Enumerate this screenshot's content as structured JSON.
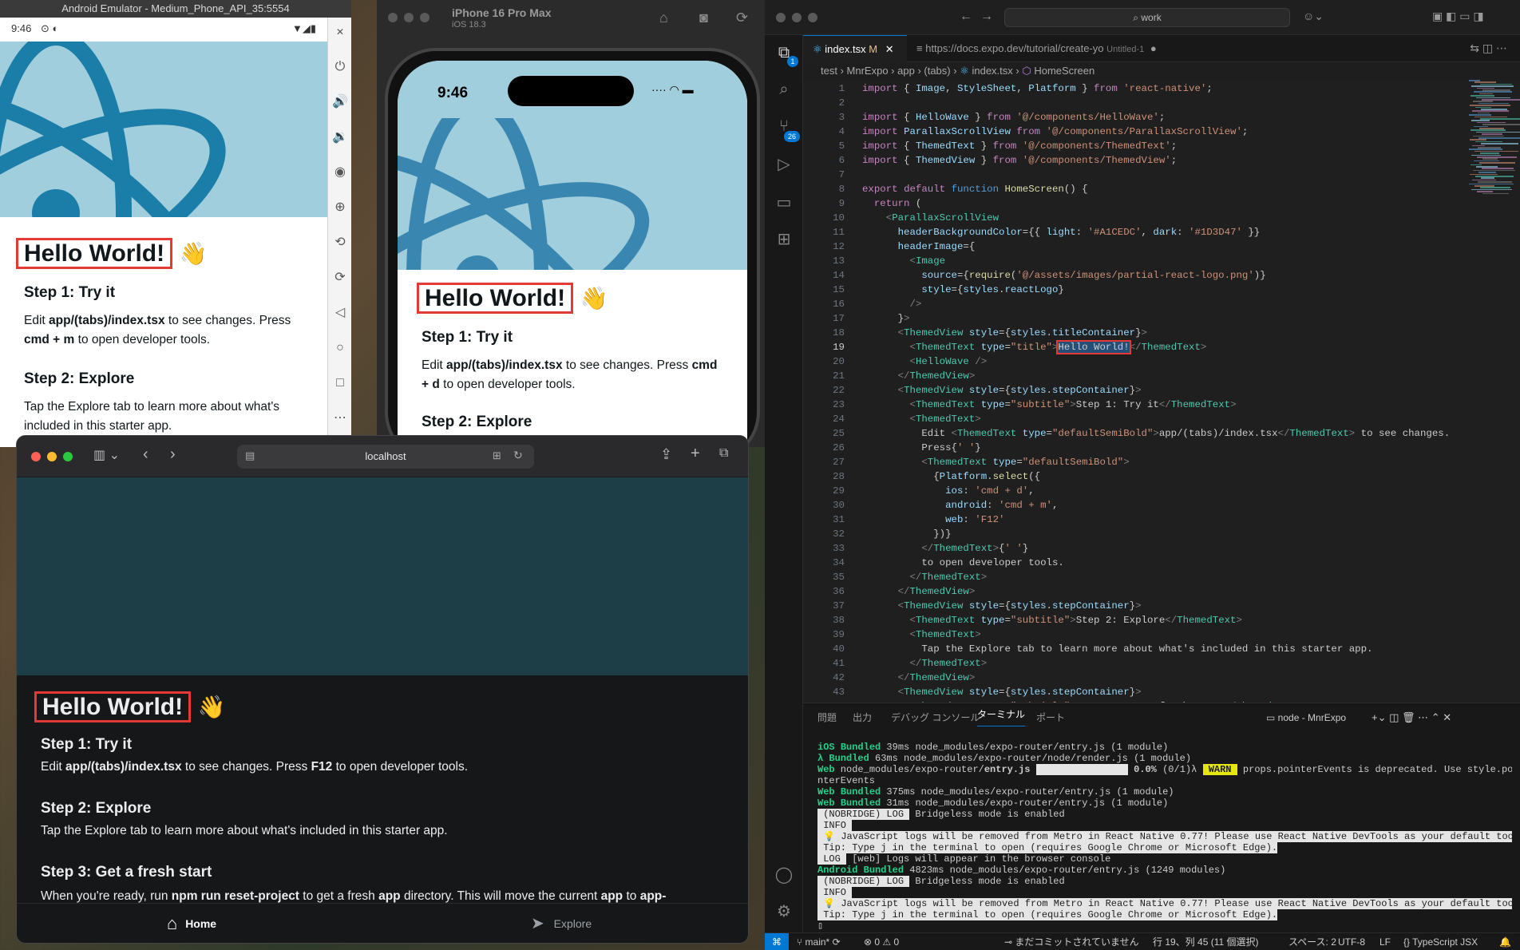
{
  "android": {
    "title": "Android Emulator - Medium_Phone_API_35:5554",
    "time": "9:46",
    "hello": "Hello World!",
    "wave": "👋",
    "step1_title": "Step 1: Try it",
    "step1_edit": "Edit ",
    "step1_path": "app/(tabs)/index.tsx",
    "step1_mid": " to see changes. Press ",
    "step1_key": "cmd + m",
    "step1_end": " to open developer tools.",
    "step2_title": "Step 2: Explore",
    "step2_text": "Tap the Explore tab to learn more about what's included in this starter app."
  },
  "iphone": {
    "title": "iPhone 16 Pro Max",
    "subtitle": "iOS 18.3",
    "time": "9:46",
    "hello": "Hello World!",
    "wave": "👋",
    "step1_title": "Step 1: Try it",
    "step1_edit": "Edit ",
    "step1_path": "app/(tabs)/index.tsx",
    "step1_mid": " to see changes. Press ",
    "step1_key": "cmd + d",
    "step1_end": " to open developer tools.",
    "step2_title": "Step 2: Explore"
  },
  "safari": {
    "url": "localhost",
    "hello": "Hello World!",
    "wave": "👋",
    "step1_title": "Step 1: Try it",
    "step1_edit": "Edit ",
    "step1_path": "app/(tabs)/index.tsx",
    "step1_mid": " to see changes. Press ",
    "step1_key": "F12",
    "step1_end": " to open developer tools.",
    "step2_title": "Step 2: Explore",
    "step2_text": "Tap the Explore tab to learn more about what's included in this starter app.",
    "step3_title": "Step 3: Get a fresh start",
    "step3_a": "When you're ready, run ",
    "step3_cmd": "npm run reset-project",
    "step3_b": " to get a fresh ",
    "step3_app": "app",
    "step3_c": " directory. This will move the current ",
    "step3_app2": "app",
    "step3_d": " to ",
    "step3_e": "app-",
    "tab_home": "Home",
    "tab_explore": "Explore"
  },
  "vscode": {
    "search": "work",
    "tab1": "index.tsx",
    "tab1_mod": "M",
    "tab2": "https://docs.expo.dev/tutorial/create-yo",
    "tab2_sub": "Untitled-1",
    "breadcrumb": [
      "test",
      "MnrExpo",
      "app",
      "(tabs)",
      "index.tsx",
      "HomeScreen"
    ],
    "explorer_badge": "1",
    "scm_badge": "26",
    "panel_tabs": [
      "問題",
      "出力",
      "デバッグ コンソール",
      "ターミナル",
      "ポート"
    ],
    "terminal_name": "node - MnrExpo",
    "status": {
      "branch": "main*",
      "errors": "0",
      "warnings": "0",
      "commit": "まだコミットされていません",
      "position": "行 19、列 45 (11 個選択)",
      "spaces": "スペース: 2",
      "encoding": "UTF-8",
      "eol": "LF",
      "language": "TypeScript JSX"
    }
  }
}
